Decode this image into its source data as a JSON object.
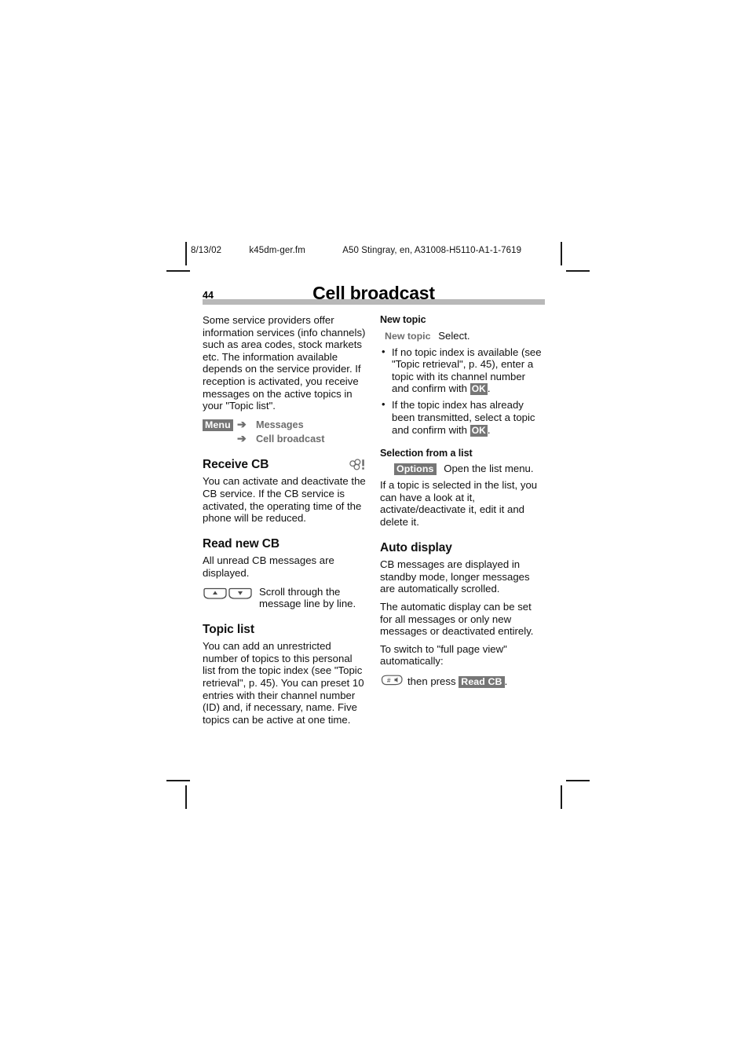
{
  "crop_marks": {
    "present": true
  },
  "running_header": {
    "date": "8/13/02",
    "filename": "k45dm-ger.fm",
    "document_id": "A50 Stingray, en, A31008-H5110-A1-1-7619"
  },
  "page": {
    "number": "44",
    "title": "Cell broadcast"
  },
  "colors": {
    "chip_background": "#767676",
    "chip_text": "#ffffff",
    "title_rule": "#b8b8b8",
    "softkey_label": "#6d6d6d",
    "body_text": "#111111"
  },
  "left_column": {
    "intro_paragraph": "Some service providers offer information services (info channels) such as area codes, stock markets etc. The information available depends on the service provider. If reception is activated, you receive messages on the active topics in your \"Topic list\".",
    "menu_path": {
      "key_label": "Menu",
      "arrow": "➔",
      "items": [
        "Messages",
        "Cell broadcast"
      ]
    },
    "receive_cb": {
      "heading": "Receive CB",
      "icon": "cell-broadcast-icon",
      "body": "You can activate and deactivate the CB service. If the CB service is activated, the operating time of the phone will be reduced."
    },
    "read_new_cb": {
      "heading": "Read new CB",
      "body": "All unread CB messages are displayed.",
      "key_icon": "rocker-key-up-down-icon",
      "key_description": "Scroll through the message line by line."
    },
    "topic_list": {
      "heading": "Topic list",
      "body": "You can add an unrestricted number of topics to this personal list from the topic index (see \"Topic retrieval\", p. 45). You can preset 10 entries with their channel number (ID) and, if necessary, name. Five topics can be active at one time."
    }
  },
  "right_column": {
    "new_topic": {
      "heading": "New topic",
      "softkey_label": "New topic",
      "softkey_action": "Select.",
      "bullets": [
        {
          "text_before": "If no topic index is available (see \"Topic retrieval\", p. 45), enter a topic with its channel number and confirm with ",
          "chip": "OK",
          "text_after": "."
        },
        {
          "text_before": "If the topic index has already been transmitted, select a topic and confirm with ",
          "chip": "OK",
          "text_after": "."
        }
      ]
    },
    "selection_from_list": {
      "heading": "Selection from a list",
      "chip": "Options",
      "chip_action": "Open the list menu.",
      "body": "If a topic is selected in the list, you can have a look at it, activate/deactivate it, edit it and delete it."
    },
    "auto_display": {
      "heading": "Auto display",
      "paragraph_1": "CB messages are displayed in standby mode, longer messages are automatically scrolled.",
      "paragraph_2": "The automatic display can be set for all messages or only new messages or deactivated entirely.",
      "paragraph_3": "To switch to \"full page view\" automatically:",
      "key_icon": "hash-key-icon",
      "then_press_text": "then press",
      "chip": "Read CB",
      "trailing": "."
    }
  }
}
